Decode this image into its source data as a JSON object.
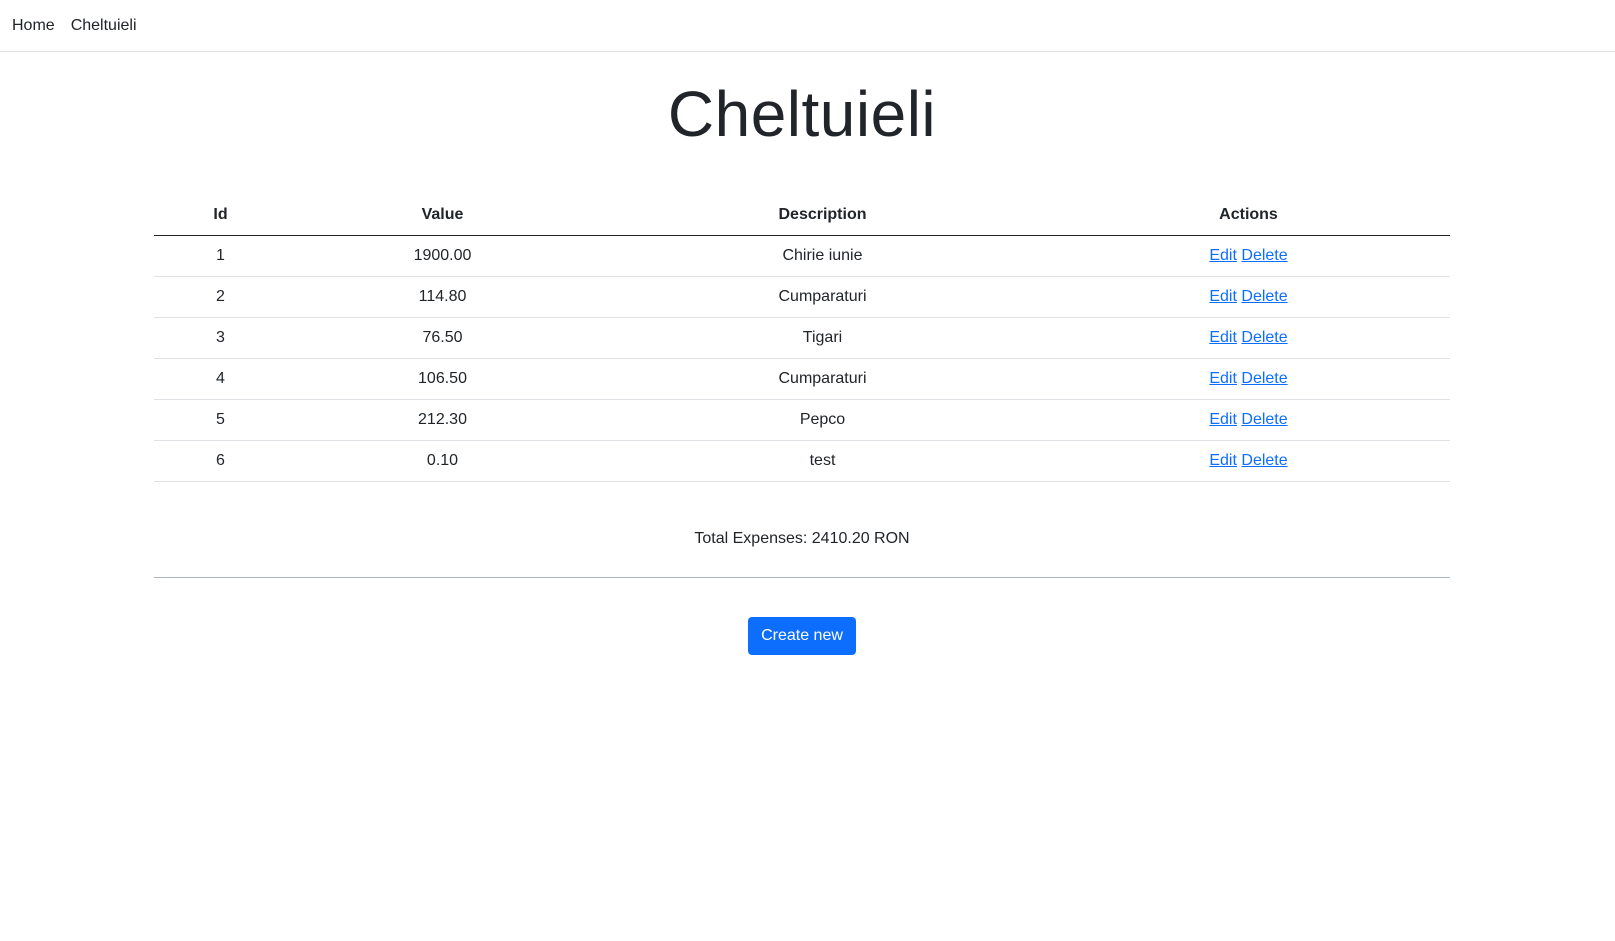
{
  "nav": {
    "items": [
      {
        "label": "Home"
      },
      {
        "label": "Cheltuieli"
      }
    ]
  },
  "page": {
    "title": "Cheltuieli"
  },
  "table": {
    "headers": {
      "id": "Id",
      "value": "Value",
      "description": "Description",
      "actions": "Actions"
    },
    "rows": [
      {
        "id": "1",
        "value": "1900.00",
        "description": "Chirie iunie",
        "edit": "Edit",
        "delete": "Delete"
      },
      {
        "id": "2",
        "value": "114.80",
        "description": "Cumparaturi",
        "edit": "Edit",
        "delete": "Delete"
      },
      {
        "id": "3",
        "value": "76.50",
        "description": "Tigari",
        "edit": "Edit",
        "delete": "Delete"
      },
      {
        "id": "4",
        "value": "106.50",
        "description": "Cumparaturi",
        "edit": "Edit",
        "delete": "Delete"
      },
      {
        "id": "5",
        "value": "212.30",
        "description": "Pepco",
        "edit": "Edit",
        "delete": "Delete"
      },
      {
        "id": "6",
        "value": "0.10",
        "description": "test",
        "edit": "Edit",
        "delete": "Delete"
      }
    ]
  },
  "summary": {
    "total_text": "Total Expenses: 2410.20 RON"
  },
  "actions": {
    "create_label": "Create new"
  },
  "colors": {
    "primary": "#0d6efd",
    "text": "#212529",
    "border": "#dee2e6"
  }
}
